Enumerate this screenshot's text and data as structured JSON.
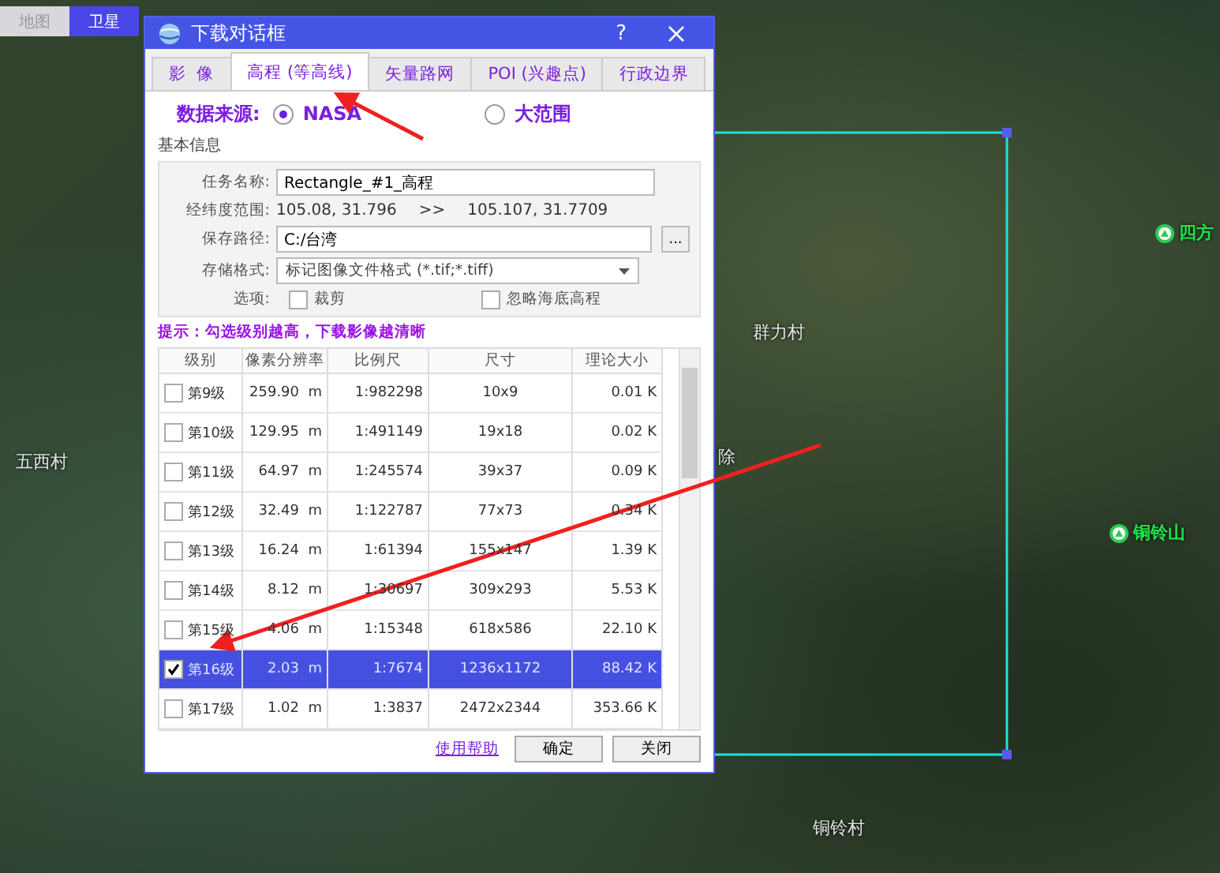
{
  "map_tabs": [
    {
      "label": "地图",
      "selected": false
    },
    {
      "label": "卫星",
      "selected": true
    }
  ],
  "map_labels": [
    {
      "text": "四方",
      "kind": "peak"
    },
    {
      "text": "铜铃山",
      "kind": "peak"
    },
    {
      "text": "群力村",
      "kind": "village"
    },
    {
      "text": "五西村",
      "kind": "village"
    },
    {
      "text": "除",
      "kind": "village"
    },
    {
      "text": "铜铃村",
      "kind": "village"
    }
  ],
  "dialog": {
    "title": "下载对话框",
    "help": "?",
    "tabs": [
      {
        "label": "影  像",
        "selected": false
      },
      {
        "label": "高程 (等高线)",
        "selected": true
      },
      {
        "label": "矢量路网",
        "selected": false
      },
      {
        "label": "POI (兴趣点)",
        "selected": false
      },
      {
        "label": "行政边界",
        "selected": false
      }
    ],
    "data_source": {
      "label": "数据来源:",
      "options": [
        {
          "label": "NASA",
          "selected": true
        },
        {
          "label": "大范围",
          "selected": false
        }
      ]
    },
    "basic_info": {
      "title": "基本信息",
      "task_name": {
        "label": "任务名称:",
        "value": "Rectangle_#1_高程"
      },
      "range": {
        "label": "经纬度范围:",
        "from": "105.08, 31.796",
        "separator": ">>",
        "to": "105.107, 31.7709"
      },
      "save_path": {
        "label": "保存路径:",
        "value": "C:/台湾",
        "browse": "..."
      },
      "format": {
        "label": "存储格式:",
        "value": "标记图像文件格式 (*.tif;*.tiff)"
      },
      "options": {
        "label": "选项:",
        "items": [
          {
            "label": "裁剪",
            "checked": false
          },
          {
            "label": "忽略海底高程",
            "checked": false
          }
        ]
      }
    },
    "hint": "提示：勾选级别越高，下载影像越清晰",
    "table": {
      "columns": [
        "级别",
        "像素分辨率",
        "比例尺",
        "尺寸",
        "理论大小"
      ],
      "rows": [
        {
          "level": "第9级",
          "resolution": "259.90",
          "unit": "m",
          "scale": "1:982298",
          "size": "10x9",
          "data_size": "0.01 K",
          "checked": false,
          "selected": false
        },
        {
          "level": "第10级",
          "resolution": "129.95",
          "unit": "m",
          "scale": "1:491149",
          "size": "19x18",
          "data_size": "0.02 K",
          "checked": false,
          "selected": false
        },
        {
          "level": "第11级",
          "resolution": "64.97",
          "unit": "m",
          "scale": "1:245574",
          "size": "39x37",
          "data_size": "0.09 K",
          "checked": false,
          "selected": false
        },
        {
          "level": "第12级",
          "resolution": "32.49",
          "unit": "m",
          "scale": "1:122787",
          "size": "77x73",
          "data_size": "0.34 K",
          "checked": false,
          "selected": false
        },
        {
          "level": "第13级",
          "resolution": "16.24",
          "unit": "m",
          "scale": "1:61394",
          "size": "155x147",
          "data_size": "1.39 K",
          "checked": false,
          "selected": false
        },
        {
          "level": "第14级",
          "resolution": "8.12",
          "unit": "m",
          "scale": "1:30697",
          "size": "309x293",
          "data_size": "5.53 K",
          "checked": false,
          "selected": false
        },
        {
          "level": "第15级",
          "resolution": "4.06",
          "unit": "m",
          "scale": "1:15348",
          "size": "618x586",
          "data_size": "22.10 K",
          "checked": false,
          "selected": false
        },
        {
          "level": "第16级",
          "resolution": "2.03",
          "unit": "m",
          "scale": "1:7674",
          "size": "1236x1172",
          "data_size": "88.42 K",
          "checked": true,
          "selected": true
        },
        {
          "level": "第17级",
          "resolution": "1.02",
          "unit": "m",
          "scale": "1:3837",
          "size": "2472x2344",
          "data_size": "353.66 K",
          "checked": false,
          "selected": false
        }
      ]
    },
    "footer": {
      "help_link": "使用帮助",
      "buttons": [
        "确定",
        "关闭"
      ]
    }
  }
}
